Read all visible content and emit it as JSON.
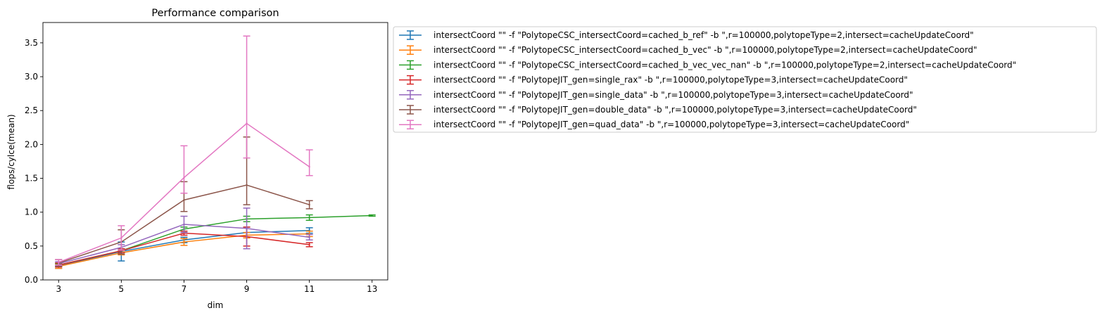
{
  "chart_data": {
    "type": "line",
    "title": "Performance comparison",
    "xlabel": "dim",
    "ylabel": "flops/cylce(mean)",
    "xlim": [
      2.5,
      13.5
    ],
    "ylim": [
      0,
      3.8
    ],
    "xticks": [
      3,
      5,
      7,
      9,
      11,
      13
    ],
    "yticks": [
      0.0,
      0.5,
      1.0,
      1.5,
      2.0,
      2.5,
      3.0,
      3.5
    ],
    "ytick_labels": [
      "0.0",
      "0.5",
      "1.0",
      "1.5",
      "2.0",
      "2.5",
      "3.0",
      "3.5"
    ],
    "grid": false,
    "legend_position": "outside-right-top",
    "series": [
      {
        "name": "intersectCoord \"\" -f \"PolytopeCSC_intersectCoord=cached_b_ref\" -b \",r=100000,polytopeType=2,intersect=cacheUpdateCoord\"",
        "color": "#1f77b4",
        "x": [
          3,
          5,
          7,
          9,
          11
        ],
        "y": [
          0.21,
          0.42,
          0.59,
          0.7,
          0.73
        ],
        "err_low": [
          0.17,
          0.28,
          0.55,
          0.62,
          0.69
        ],
        "err_high": [
          0.25,
          0.56,
          0.63,
          0.78,
          0.77
        ]
      },
      {
        "name": "intersectCoord \"\" -f \"PolytopeCSC_intersectCoord=cached_b_vec\" -b \",r=100000,polytopeType=2,intersect=cacheUpdateCoord\"",
        "color": "#ff7f0e",
        "x": [
          3,
          5,
          7,
          9,
          11
        ],
        "y": [
          0.2,
          0.4,
          0.56,
          0.66,
          0.68
        ],
        "err_low": [
          0.17,
          0.37,
          0.51,
          0.62,
          0.64
        ],
        "err_high": [
          0.23,
          0.43,
          0.61,
          0.7,
          0.72
        ]
      },
      {
        "name": "intersectCoord \"\" -f \"PolytopeCSC_intersectCoord=cached_b_vec_vec_nan\" -b \",r=100000,polytopeType=2,intersect=cacheUpdateCoord\"",
        "color": "#2ca02c",
        "x": [
          3,
          5,
          7,
          9,
          11,
          13
        ],
        "y": [
          0.22,
          0.43,
          0.75,
          0.9,
          0.92,
          0.95
        ],
        "err_low": [
          0.2,
          0.4,
          0.72,
          0.86,
          0.88,
          0.94
        ],
        "err_high": [
          0.24,
          0.46,
          0.78,
          0.94,
          0.96,
          0.96
        ]
      },
      {
        "name": "intersectCoord \"\" -f \"PolytopeJIT_gen=single_rax\" -b \",r=100000,polytopeType=3,intersect=cacheUpdateCoord\"",
        "color": "#d62728",
        "x": [
          3,
          5,
          7,
          9,
          11
        ],
        "y": [
          0.22,
          0.43,
          0.69,
          0.64,
          0.52
        ],
        "err_low": [
          0.19,
          0.4,
          0.66,
          0.5,
          0.49
        ],
        "err_high": [
          0.25,
          0.46,
          0.72,
          0.78,
          0.55
        ]
      },
      {
        "name": "intersectCoord \"\" -f \"PolytopeJIT_gen=single_data\" -b \",r=100000,polytopeType=3,intersect=cacheUpdateCoord\"",
        "color": "#9467bd",
        "x": [
          3,
          5,
          7,
          9,
          11
        ],
        "y": [
          0.24,
          0.48,
          0.82,
          0.76,
          0.63
        ],
        "err_low": [
          0.21,
          0.44,
          0.7,
          0.46,
          0.59
        ],
        "err_high": [
          0.27,
          0.52,
          0.94,
          1.06,
          0.67
        ]
      },
      {
        "name": "intersectCoord \"\" -f \"PolytopeJIT_gen=double_data\" -b \",r=100000,polytopeType=3,intersect=cacheUpdateCoord\"",
        "color": "#8c564b",
        "x": [
          3,
          5,
          7,
          9,
          11
        ],
        "y": [
          0.25,
          0.56,
          1.18,
          1.4,
          1.11
        ],
        "err_low": [
          0.2,
          0.38,
          1.01,
          1.11,
          1.05
        ],
        "err_high": [
          0.3,
          0.74,
          1.45,
          2.11,
          1.17
        ]
      },
      {
        "name": "intersectCoord \"\" -f \"PolytopeJIT_gen=quad_data\" -b \",r=100000,polytopeType=3,intersect=cacheUpdateCoord\"",
        "color": "#e377c2",
        "x": [
          3,
          5,
          7,
          9,
          11
        ],
        "y": [
          0.26,
          0.62,
          1.51,
          2.31,
          1.67
        ],
        "err_low": [
          0.22,
          0.44,
          1.28,
          1.8,
          1.54
        ],
        "err_high": [
          0.3,
          0.8,
          1.98,
          3.6,
          1.92
        ]
      }
    ]
  }
}
